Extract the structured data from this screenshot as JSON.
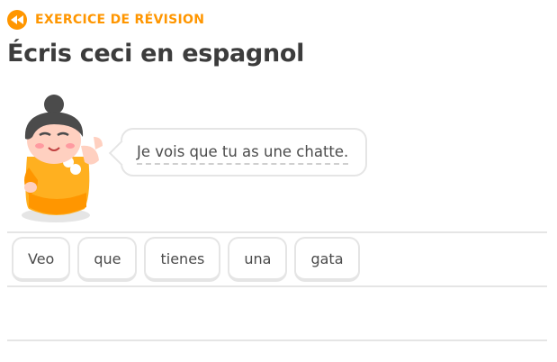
{
  "header": {
    "review_label": "EXERCICE DE RÉVISION",
    "review_icon": "rewind-icon",
    "title": "Écris ceci en espagnol"
  },
  "prompt": {
    "sentence": "Je vois que tu as une chatte.",
    "character_icon": "character-illustration"
  },
  "word_bank": {
    "words": [
      "Veo",
      "que",
      "tienes",
      "una",
      "gata"
    ]
  },
  "colors": {
    "accent": "#ff9600",
    "border": "#e5e5e5",
    "text": "#3c3c3c"
  }
}
